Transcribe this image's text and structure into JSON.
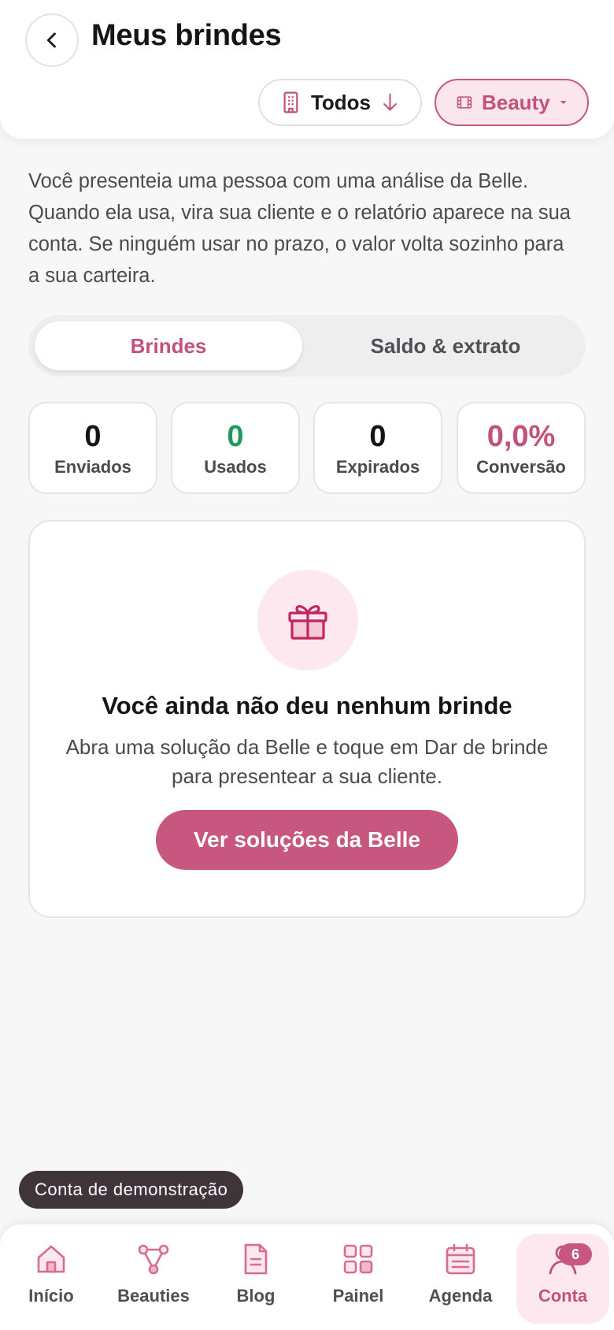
{
  "header": {
    "title": "Meus brindes",
    "filter_todos": "Todos",
    "filter_beauty": "Beauty"
  },
  "intro": "Você presenteia uma pessoa com uma análise da Belle. Quando ela usa, vira sua cliente e o relatório aparece na sua conta. Se ninguém usar no prazo, o valor volta sozinho para a sua carteira.",
  "tabs": [
    {
      "label": "Brindes",
      "active": true
    },
    {
      "label": "Saldo & extrato",
      "active": false
    }
  ],
  "stats": [
    {
      "value": "0",
      "label": "Enviados",
      "color": "#151515"
    },
    {
      "value": "0",
      "label": "Usados",
      "color": "#1f9a5c"
    },
    {
      "value": "0",
      "label": "Expirados",
      "color": "#151515"
    },
    {
      "value": "0,0%",
      "label": "Conversão",
      "color": "#c2527c"
    }
  ],
  "empty": {
    "icon": "gift-icon",
    "title": "Você ainda não deu nenhum brinde",
    "description": "Abra uma solução da Belle e toque em Dar de brinde para presentear a sua cliente.",
    "cta": "Ver soluções da Belle"
  },
  "demo_badge": "Conta de demonstração",
  "nav": [
    {
      "label": "Início",
      "icon": "home-icon"
    },
    {
      "label": "Beauties",
      "icon": "network-icon"
    },
    {
      "label": "Blog",
      "icon": "document-icon"
    },
    {
      "label": "Painel",
      "icon": "grid-icon"
    },
    {
      "label": "Agenda",
      "icon": "calendar-icon"
    },
    {
      "label": "Conta",
      "icon": "user-icon",
      "active": true,
      "badge": "6"
    }
  ],
  "colors": {
    "accent": "#c8577f",
    "accent_soft": "#fde8ef",
    "success": "#1f9a5c"
  }
}
